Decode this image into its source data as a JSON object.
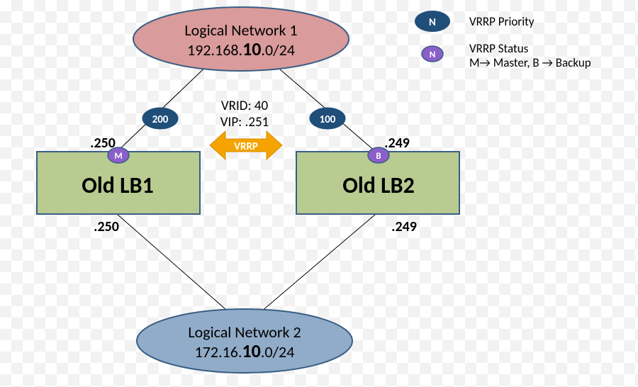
{
  "net1": {
    "title": "Logical Network 1",
    "cidr_a": "192.168.",
    "cidr_b": "10",
    "cidr_c": ".0/24"
  },
  "net2": {
    "title": "Logical Network 2",
    "cidr_a": "172.16.",
    "cidr_b": "10",
    "cidr_c": ".0/24"
  },
  "lb1": {
    "name": "Old LB1",
    "top_ip": ".250",
    "bottom_ip": ".250",
    "priority": "200",
    "status": "M"
  },
  "lb2": {
    "name": "Old LB2",
    "top_ip": ".249",
    "bottom_ip": ".249",
    "priority": "100",
    "status": "B"
  },
  "vrrp": {
    "vrid": "VRID: 40",
    "vip": "VIP: .251",
    "arrow_label": "VRRP"
  },
  "legend": {
    "priority_badge": "N",
    "priority_label": "VRRP Priority",
    "status_badge": "N",
    "status_label_1": "VRRP Status",
    "status_label_2": "M→ Master, B → Backup"
  }
}
